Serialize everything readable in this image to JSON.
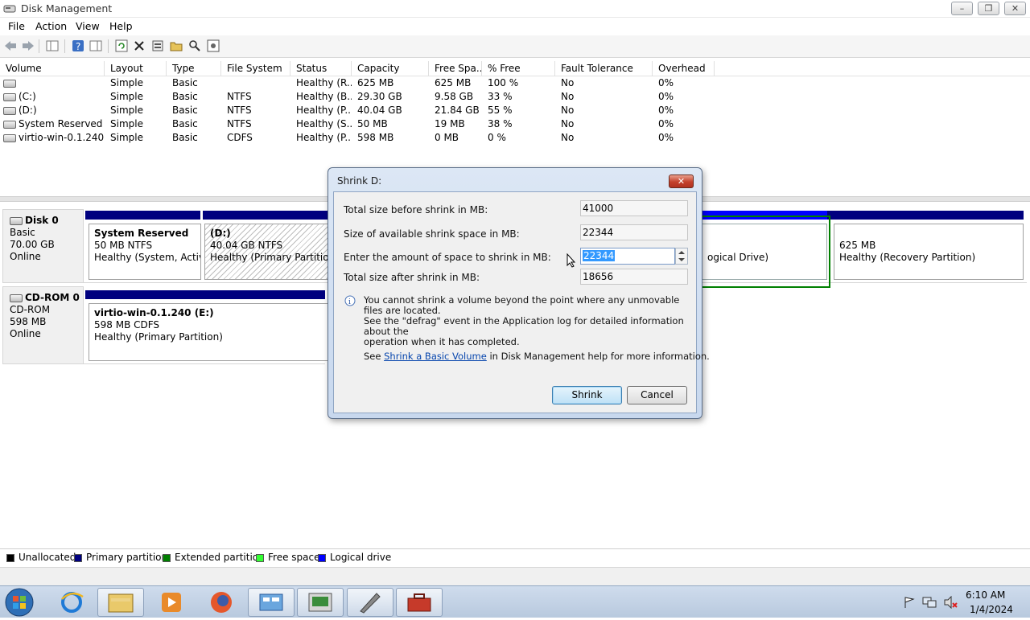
{
  "window": {
    "title": "Disk Management"
  },
  "menu": [
    "File",
    "Action",
    "View",
    "Help"
  ],
  "columns": [
    "Volume",
    "Layout",
    "Type",
    "File System",
    "Status",
    "Capacity",
    "Free Spa...",
    "% Free",
    "Fault Tolerance",
    "Overhead"
  ],
  "volumes": [
    {
      "volume": "",
      "layout": "Simple",
      "type": "Basic",
      "fs": "",
      "status": "Healthy (R...",
      "capacity": "625 MB",
      "free": "625 MB",
      "pct": "100 %",
      "fault": "No",
      "overhead": "0%"
    },
    {
      "volume": "(C:)",
      "layout": "Simple",
      "type": "Basic",
      "fs": "NTFS",
      "status": "Healthy (B...",
      "capacity": "29.30 GB",
      "free": "9.58 GB",
      "pct": "33 %",
      "fault": "No",
      "overhead": "0%"
    },
    {
      "volume": "(D:)",
      "layout": "Simple",
      "type": "Basic",
      "fs": "NTFS",
      "status": "Healthy (P...",
      "capacity": "40.04 GB",
      "free": "21.84 GB",
      "pct": "55 %",
      "fault": "No",
      "overhead": "0%"
    },
    {
      "volume": "System Reserved",
      "layout": "Simple",
      "type": "Basic",
      "fs": "NTFS",
      "status": "Healthy (S...",
      "capacity": "50 MB",
      "free": "19 MB",
      "pct": "38 %",
      "fault": "No",
      "overhead": "0%"
    },
    {
      "volume": "virtio-win-0.1.240 ...",
      "layout": "Simple",
      "type": "Basic",
      "fs": "CDFS",
      "status": "Healthy (P...",
      "capacity": "598 MB",
      "free": "0 MB",
      "pct": "0 %",
      "fault": "No",
      "overhead": "0%"
    }
  ],
  "disk0": {
    "name": "Disk 0",
    "type": "Basic",
    "size": "70.00 GB",
    "state": "Online",
    "partitions": {
      "sysres": {
        "title": "System Reserved",
        "size": "50 MB NTFS",
        "status": "Healthy (System, Active,"
      },
      "d": {
        "title": "(D:)",
        "size": "40.04 GB NTFS",
        "status": "Healthy (Primary Partition)"
      },
      "logical_fragment": "ogical Drive)",
      "recovery": {
        "size": "625 MB",
        "status": "Healthy (Recovery Partition)"
      }
    }
  },
  "cdrom0": {
    "name": "CD-ROM 0",
    "type": "CD-ROM",
    "size": "598 MB",
    "state": "Online",
    "partition": {
      "title": "virtio-win-0.1.240  (E:)",
      "size": "598 MB CDFS",
      "status": "Healthy (Primary Partition)"
    }
  },
  "legend": [
    {
      "label": "Unallocated",
      "color": "#000000"
    },
    {
      "label": "Primary partition",
      "color": "#00007f"
    },
    {
      "label": "Extended partition",
      "color": "#007f00"
    },
    {
      "label": "Free space",
      "color": "#33ff33"
    },
    {
      "label": "Logical drive",
      "color": "#0000ff"
    }
  ],
  "dialog": {
    "title": "Shrink D:",
    "total_before_label": "Total size before shrink in MB:",
    "total_before_value": "41000",
    "available_label": "Size of available shrink space in MB:",
    "available_value": "22344",
    "enter_label": "Enter the amount of space to shrink in MB:",
    "enter_value": "22344",
    "after_label": "Total size after shrink in MB:",
    "after_value": "18656",
    "info_line1": "You cannot shrink a volume beyond the point where any unmovable files are located.",
    "info_line2": "See the \"defrag\" event in the Application log for detailed information about the",
    "info_line3": "operation when it has completed.",
    "see_prefix": "See",
    "see_link": "Shrink a Basic Volume",
    "see_suffix": "in Disk Management help for more information.",
    "shrink_button": "Shrink",
    "cancel_button": "Cancel"
  },
  "taskbar": {
    "time": "6:10 AM",
    "date": "1/4/2024"
  }
}
